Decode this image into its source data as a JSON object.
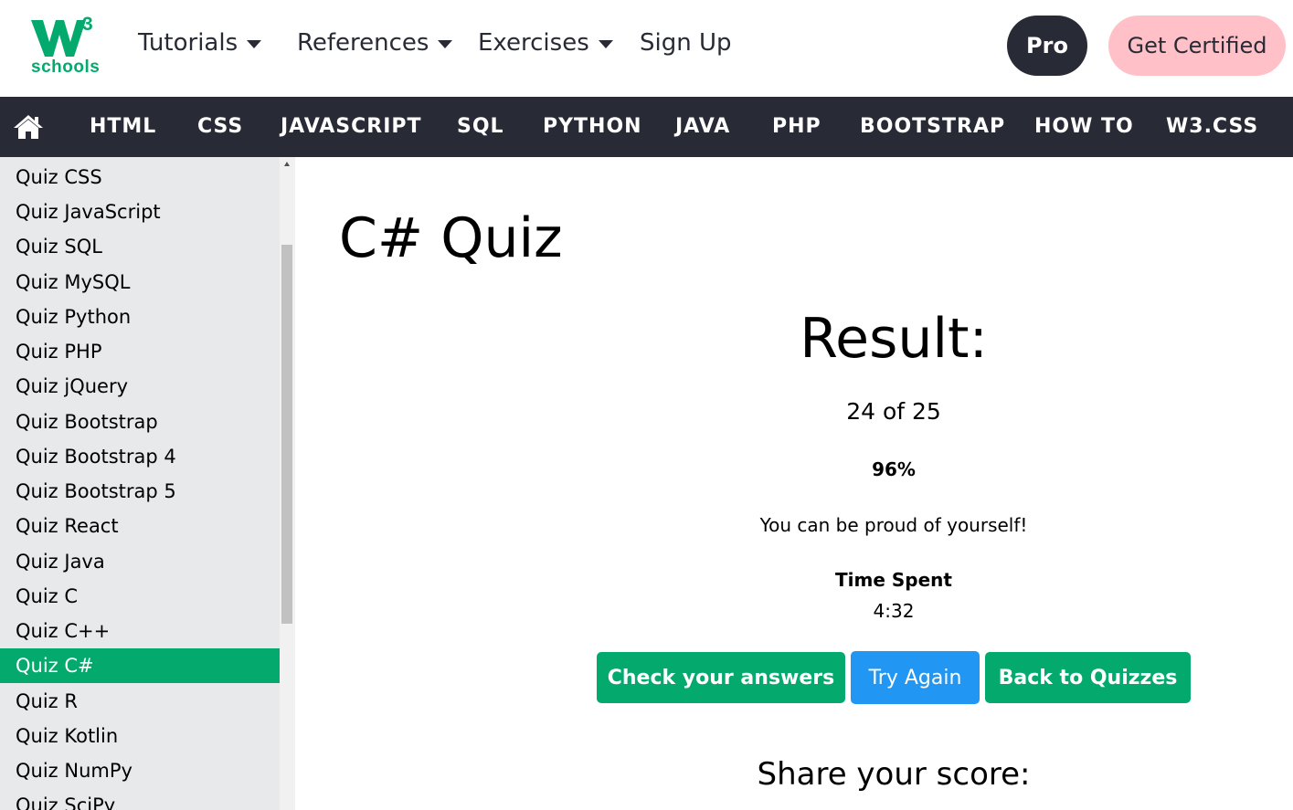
{
  "logo": {
    "superscript": "3",
    "word": "schools",
    "brand_color": "#04AA6D"
  },
  "top_nav": {
    "tutorials": "Tutorials",
    "references": "References",
    "exercises": "Exercises",
    "sign_up": "Sign Up",
    "pro": "Pro",
    "get_certified": "Get Certified"
  },
  "navbar": {
    "home_icon": "home-icon",
    "links": [
      "HTML",
      "CSS",
      "JAVASCRIPT",
      "SQL",
      "PYTHON",
      "JAVA",
      "PHP",
      "BOOTSTRAP",
      "HOW TO",
      "W3.CSS"
    ]
  },
  "sidebar": {
    "items": [
      "Quiz CSS",
      "Quiz JavaScript",
      "Quiz SQL",
      "Quiz MySQL",
      "Quiz Python",
      "Quiz PHP",
      "Quiz jQuery",
      "Quiz Bootstrap",
      "Quiz Bootstrap 4",
      "Quiz Bootstrap 5",
      "Quiz React",
      "Quiz Java",
      "Quiz C",
      "Quiz C++",
      "Quiz C#",
      "Quiz R",
      "Quiz Kotlin",
      "Quiz NumPy",
      "Quiz SciPy"
    ],
    "active_item": "Quiz C#"
  },
  "main": {
    "title": "C# Quiz",
    "result_heading": "Result:",
    "score": "24 of 25",
    "percent": "96%",
    "message": "You can be proud of yourself!",
    "time_spent_label": "Time Spent",
    "time_spent_value": "4:32",
    "buttons": {
      "check": "Check your answers",
      "try_again": "Try Again",
      "back": "Back to Quizzes"
    },
    "share_heading": "Share your score:"
  },
  "colors": {
    "green": "#04AA6D",
    "blue": "#2196F3",
    "dark": "#282A35",
    "pink": "#FFC0C7",
    "sidebar_bg": "#E7E9EB"
  }
}
